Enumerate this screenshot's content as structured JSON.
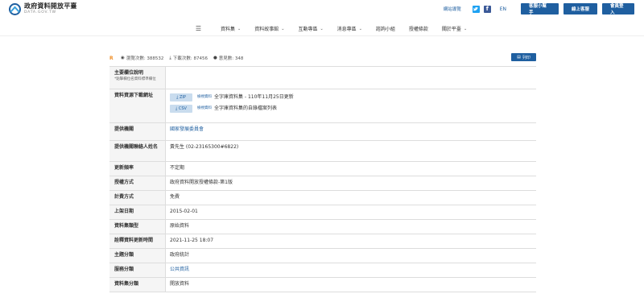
{
  "header": {
    "logo_title": "政府資料開放平臺",
    "logo_sub": "DATA.GOV.TW",
    "sitemap": "網站導覽",
    "lang": "EN",
    "btn_helper": "客服小幫手",
    "btn_online": "線上客服",
    "btn_login": "會員登入",
    "social": [
      "twitter-icon",
      "facebook-icon"
    ]
  },
  "nav": {
    "items": [
      "資料集",
      "資料故事館",
      "互動專區",
      "消息專區",
      "諮詢小組",
      "授權條款",
      "關於平臺"
    ]
  },
  "infobar": {
    "views": "瀏覽次數: 388532",
    "downloads": "下載次數: 87456",
    "comments": "意見數: 348",
    "print": "列印"
  },
  "table": {
    "main_field_label": "主要欄位說明",
    "main_field_sub": "*點擊欄位名資料標準欄位",
    "main_field_value": "",
    "download_label": "資料資源下載網址",
    "downloads": [
      {
        "format": "ZIP",
        "preview": "檢視資料",
        "desc": "全字庫資料集 - 110年11月25日更新"
      },
      {
        "format": "CSV",
        "preview": "檢視資料",
        "desc": "全字庫資料集的自錄檔案列表"
      }
    ],
    "rows": [
      {
        "label": "提供機關",
        "value": "國家發展委員會",
        "link": true
      },
      {
        "label": "提供機關聯絡人姓名",
        "value": "黃先生 (02-23165300#6822)",
        "link": false
      },
      {
        "label": "更新頻率",
        "value": "不定期",
        "link": false
      },
      {
        "label": "授權方式",
        "value": "政府資料開放授權條款-第1版",
        "link": false
      },
      {
        "label": "計費方式",
        "value": "免費",
        "link": false
      },
      {
        "label": "上架日期",
        "value": "2015-02-01",
        "link": false
      },
      {
        "label": "資料集類型",
        "value": "原始資料",
        "link": false
      },
      {
        "label": "詮釋資料更新時間",
        "value": "2021-11-25 18:07",
        "link": false
      },
      {
        "label": "主題分類",
        "value": "政府統計",
        "link": false
      },
      {
        "label": "服務分類",
        "value": "公共資訊",
        "link": true
      },
      {
        "label": "資料集分類",
        "value": "開放資料",
        "link": false
      }
    ]
  }
}
